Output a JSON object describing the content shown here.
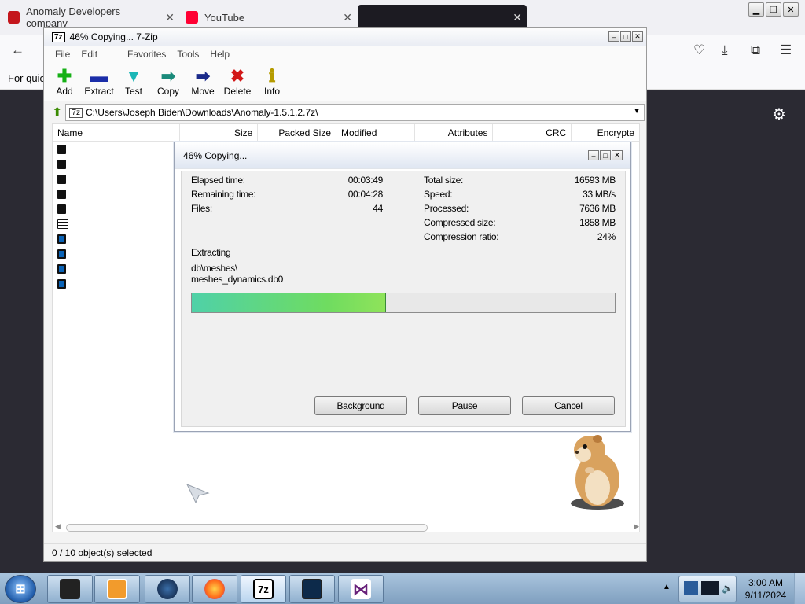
{
  "browser": {
    "tabs": [
      {
        "label": "Anomaly Developers company",
        "icon": "tools-icon"
      },
      {
        "label": "YouTube",
        "icon": "youtube-icon"
      }
    ],
    "bookmarks_text": "For quick",
    "settings_icon": "gear-icon"
  },
  "sevenzip": {
    "title": "46% Copying... 7-Zip",
    "menu": [
      "File",
      "Edit",
      "Favorites",
      "Tools",
      "Help"
    ],
    "toolbar": [
      "Add",
      "Extract",
      "Test",
      "Copy",
      "Move",
      "Delete",
      "Info"
    ],
    "path": "C:\\Users\\Joseph Biden\\Downloads\\Anomaly-1.5.1.2.7z\\",
    "columns": [
      "Name",
      "Size",
      "Packed Size",
      "Modified",
      "Attributes",
      "CRC",
      "Encrypte"
    ],
    "status": "0 / 10 object(s) selected"
  },
  "progress": {
    "title": "46% Copying...",
    "elapsed_label": "Elapsed time:",
    "elapsed": "00:03:49",
    "remaining_label": "Remaining time:",
    "remaining": "00:04:28",
    "files_label": "Files:",
    "files": "44",
    "total_label": "Total size:",
    "total": "16593 MB",
    "speed_label": "Speed:",
    "speed": "33 MB/s",
    "processed_label": "Processed:",
    "processed": "7636 MB",
    "compressed_label": "Compressed size:",
    "compressed": "1858 MB",
    "ratio_label": "Compression ratio:",
    "ratio": "24%",
    "action": "Extracting",
    "path_line1": "db\\meshes\\",
    "path_line2": "meshes_dynamics.db0",
    "percent": 46,
    "buttons": {
      "background": "Background",
      "pause": "Pause",
      "cancel": "Cancel"
    }
  },
  "taskbar": {
    "time": "3:00 AM",
    "date": "9/11/2024",
    "apps": [
      "app-icon",
      "media-player-icon",
      "globe-icon",
      "firefox-icon",
      "7zip-icon",
      "monitor-icon",
      "visual-studio-icon"
    ]
  }
}
